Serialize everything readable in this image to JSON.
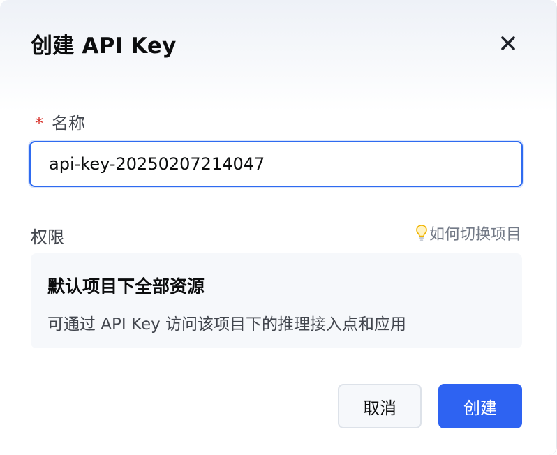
{
  "dialog": {
    "title": "创建 API Key",
    "close_icon": "close-icon"
  },
  "name_field": {
    "label": "名称",
    "required_mark": "*",
    "value": "api-key-20250207214047"
  },
  "permission": {
    "label": "权限",
    "switch_link": "如何切换项目",
    "switch_icon": "lightbulb-icon",
    "card_title": "默认项目下全部资源",
    "card_desc": "可通过 API Key 访问该项目下的推理接入点和应用"
  },
  "footer": {
    "cancel_label": "取消",
    "create_label": "创建"
  },
  "colors": {
    "accent": "#2e63f2",
    "required": "#d7312a"
  }
}
